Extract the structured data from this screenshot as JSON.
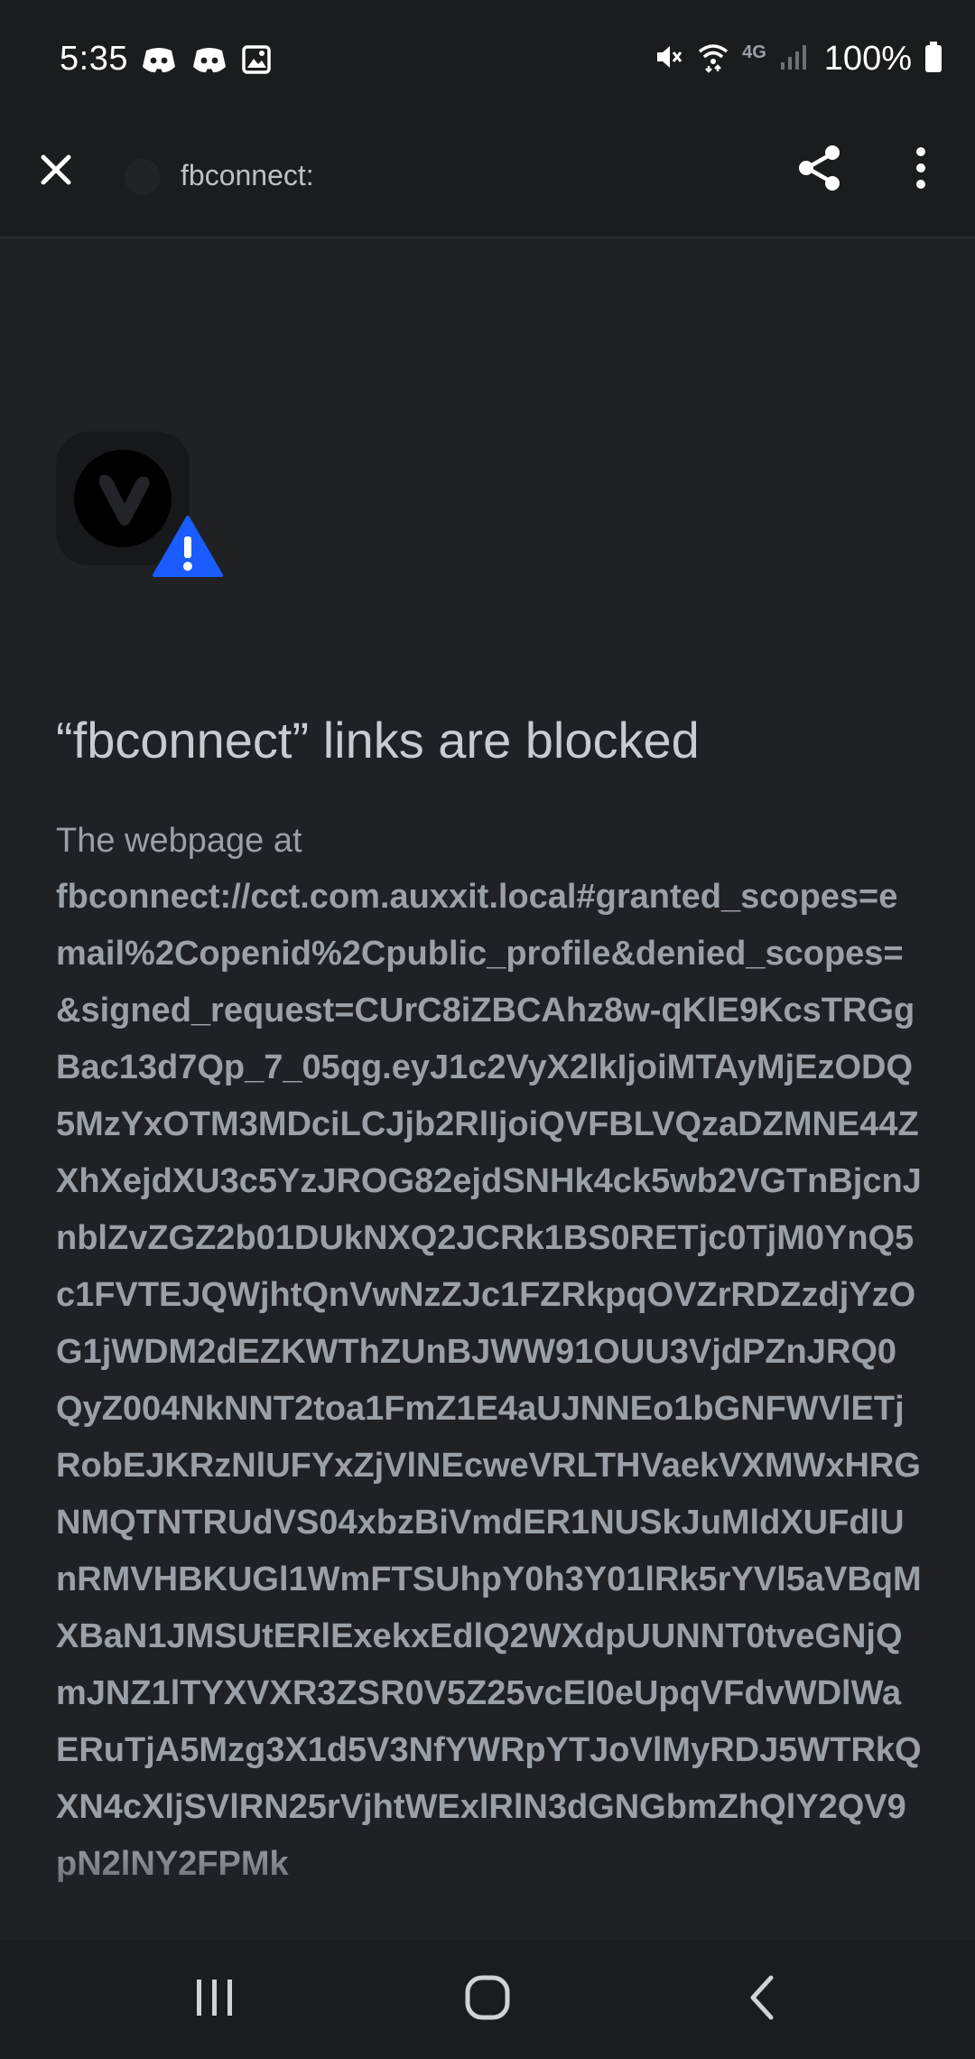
{
  "status_bar": {
    "time": "5:35",
    "battery_text": "100%",
    "network_label": "4G",
    "left_icons": [
      "discord-icon",
      "discord-icon",
      "gallery-icon"
    ],
    "right_icons": [
      "mute-icon",
      "wifi-icon",
      "signal-icon",
      "battery-icon"
    ]
  },
  "toolbar": {
    "title": "fbconnect:",
    "icons": [
      "close-icon",
      "share-icon",
      "more-vert-icon"
    ]
  },
  "content": {
    "app_icon": "vivaldi-icon",
    "badge_icon": "warning-icon",
    "title": "“fbconnect” links are blocked",
    "lead": "The webpage at",
    "url": "fbconnect://cct.com.auxxit.local#granted_scopes=email%2Copenid%2Cpublic_profile&denied_scopes=&signed_request=CUrC8iZBCAhz8w-qKlE9KcsTRGgBac13d7Qp_7_05qg.eyJ1c2VyX2lkIjoiMTAyMjEzODQ5MzYxOTM3MDciLCJjb2RlIjoiQVFBLVQzaDZMNE44ZXhXejdXU3c5YzJROG82ejdSNHk4ck5wb2VGTnBjcnJnblZvZGZ2b01DUkNXQ2JCRk1BS0RETjc0TjM0YnQ5c1FVTEJQWjhtQnVwNzZJc1FZRkpqOVZrRDZzdjYzOG1jWDM2dEZKWThZUnBJWW91OUU3VjdPZnJRQ0QyZ004NkNNT2toa1FmZ1E4aUJNNEo1bGNFWVlETjRobEJKRzNlUFYxZjVlNEcweVRLTHVaekVXMWxHRGNMQTNTRUdVS04xbzBiVmdER1NUSkJuMldXUFdlUnRMVHBKUGl1WmFTSUhpY0h3Y01lRk5rYVl5aVBqMXBaN1JMSUtERlExekxEdlQ2WXdpUUNNT0tveGNjQmJNZ1lTYXVXR3ZSR0V5Z25vcEI0eUpqVFdvWDlWaERuTjA5Mzg3X1d5V3NfYWRpYTJoVlMyRDJ5WTRkQXN4cXljSVlRN25rVjhtWExlRlN3dGNGbmZhQlY2QV9pN2lNY2FPMk"
  },
  "nav_bar": {
    "icons": [
      "recents-icon",
      "home-icon",
      "back-icon"
    ]
  },
  "colors": {
    "background": "#202124",
    "bar_background": "#1b1c1e",
    "warning_blue": "#1a5cff",
    "text_secondary": "#9aa0a6"
  }
}
